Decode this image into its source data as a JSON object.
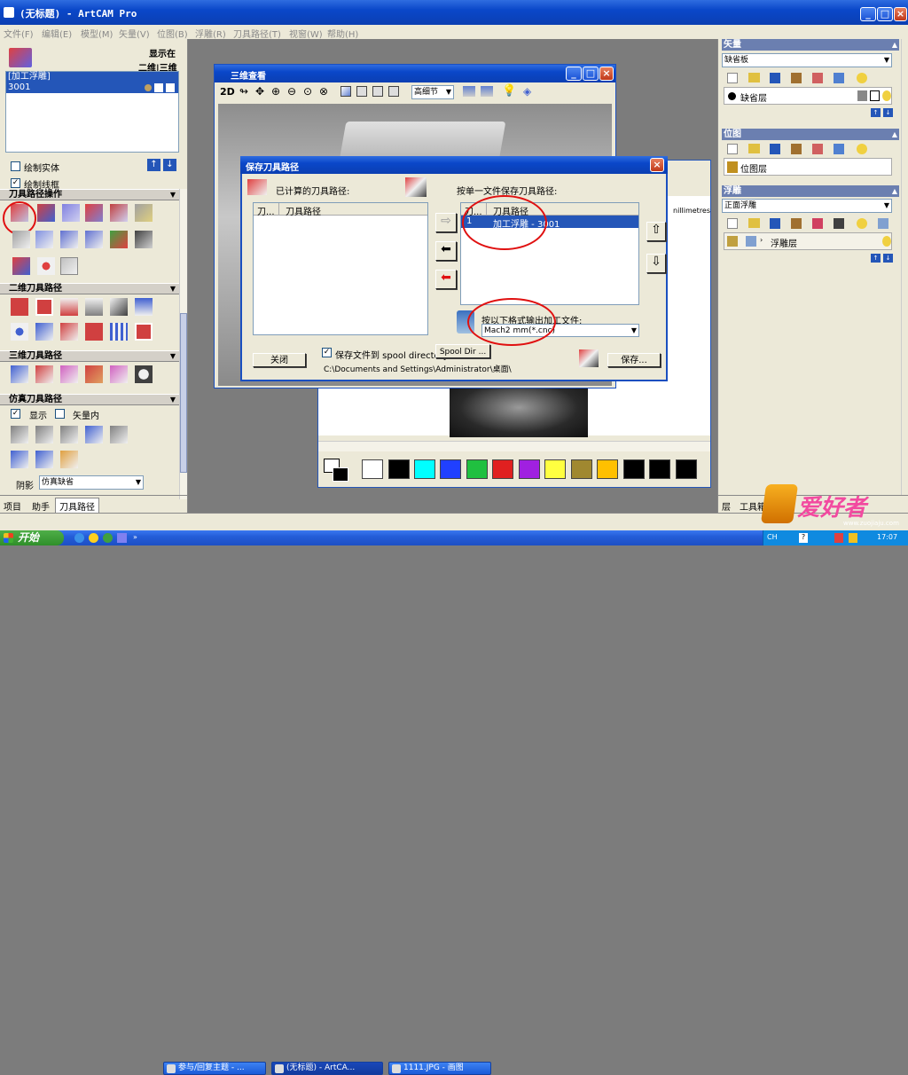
{
  "app": {
    "title": "(无标题) - ArtCAM Pro"
  },
  "menu": [
    "文件(F)",
    "编辑(E)",
    "模型(M)",
    "矢量(V)",
    "位图(B)",
    "浮雕(R)",
    "刀具路径(T)",
    "视窗(W)",
    "帮助(H)"
  ],
  "left": {
    "show_in_label": "显示在",
    "two_d_three_d": "二维|三维",
    "list_header": "[加工浮雕]",
    "list_item": "3001",
    "draw_solid": "绘制实体",
    "draw_wire": "绘制线框",
    "sections": {
      "toolpath_ops": "刀具路径操作",
      "two_d": "二维刀具路径",
      "three_d": "三维刀具路径",
      "sim": "仿真刀具路径"
    },
    "show_label": "显示",
    "in_vector_label": "矢量内",
    "shade_label": "阴影",
    "shade_value": "仿真缺省",
    "tabs": [
      "项目",
      "助手",
      "刀具路径"
    ]
  },
  "view3d": {
    "title": "三维查看",
    "mode_2d": "2D",
    "detail": "高细节"
  },
  "dialog": {
    "title": "保存刀具路径",
    "calc_label": "已计算的刀具路径:",
    "single_file_label": "按单一文件保存刀具路径:",
    "col_tool": "刀...",
    "col_path": "刀具路径",
    "right_col_tool": "刀...",
    "right_col_path": "刀具路径",
    "right_row_num": "1",
    "right_row_text": "加工浮雕 - 3001",
    "format_label": "按以下格式输出加工文件:",
    "format_value": "Mach2 mm(*.cnc)",
    "close_btn": "关闭",
    "spool_chk_label": "保存文件到 spool directory",
    "spool_btn": "Spool Dir ...",
    "path": "C:\\Documents and Settings\\Administrator\\桌面\\",
    "save_btn": "保存..."
  },
  "underlying": {
    "units_text": "nillimetres"
  },
  "right": {
    "vector": {
      "title": "矢量",
      "select_value": "缺省板",
      "layer": "缺省层"
    },
    "bitmap": {
      "title": "位图",
      "layer": "位图层"
    },
    "relief": {
      "title": "浮雕",
      "select_value": "正面浮雕",
      "layer": "浮雕层"
    },
    "tabs": [
      "层",
      "工具箱"
    ]
  },
  "palette": [
    "#ffffff",
    "#000000",
    "#00ffff",
    "#2040ff",
    "#20c040",
    "#e02020",
    "#a020e0",
    "#ffff40",
    "#a08830",
    "#ffc000",
    "#000000",
    "#000000",
    "#000000"
  ],
  "taskbar": {
    "start": "开始",
    "items": [
      "参与/回复主题 - ...",
      "(无标题) - ArtCA...",
      "1111.JPG - 画图"
    ],
    "ime": "CH",
    "clock": "17:07"
  },
  "watermark": {
    "text": "爱好者",
    "url": "www.zuojiaju.com"
  }
}
